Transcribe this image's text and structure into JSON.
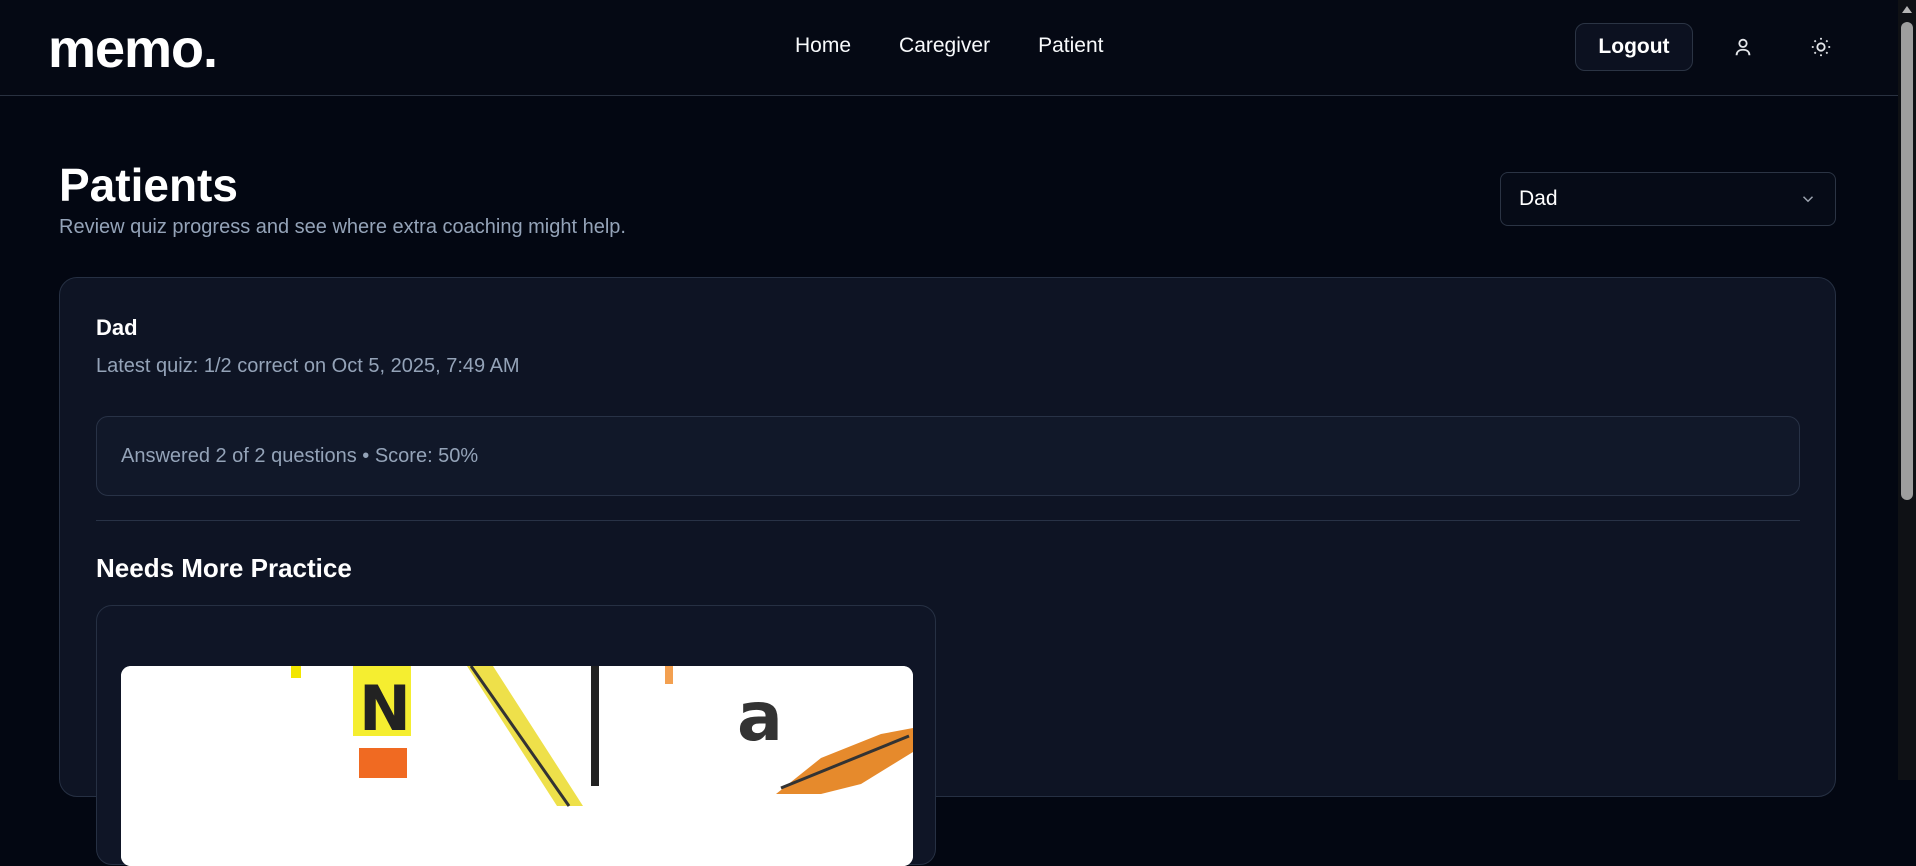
{
  "app": {
    "logo": "memo."
  },
  "nav": {
    "items": [
      "Home",
      "Caregiver",
      "Patient"
    ]
  },
  "header": {
    "logout_label": "Logout",
    "profile_icon": "user-icon",
    "theme_icon": "sun-icon"
  },
  "page": {
    "title": "Patients",
    "subtitle": "Review quiz progress and see where extra coaching might help."
  },
  "patient_select": {
    "selected": "Dad"
  },
  "patient_card": {
    "name": "Dad",
    "latest": "Latest quiz: 1/2 correct on Oct 5, 2025, 7:49 AM",
    "summary": "Answered 2 of 2 questions • Score: 50%",
    "section_title": "Needs More Practice"
  },
  "colors": {
    "background": "#030712",
    "card": "#0e1424",
    "muted": "#94a3b8",
    "accent_yellow": "#f2e600",
    "accent_orange": "#f08a20"
  }
}
